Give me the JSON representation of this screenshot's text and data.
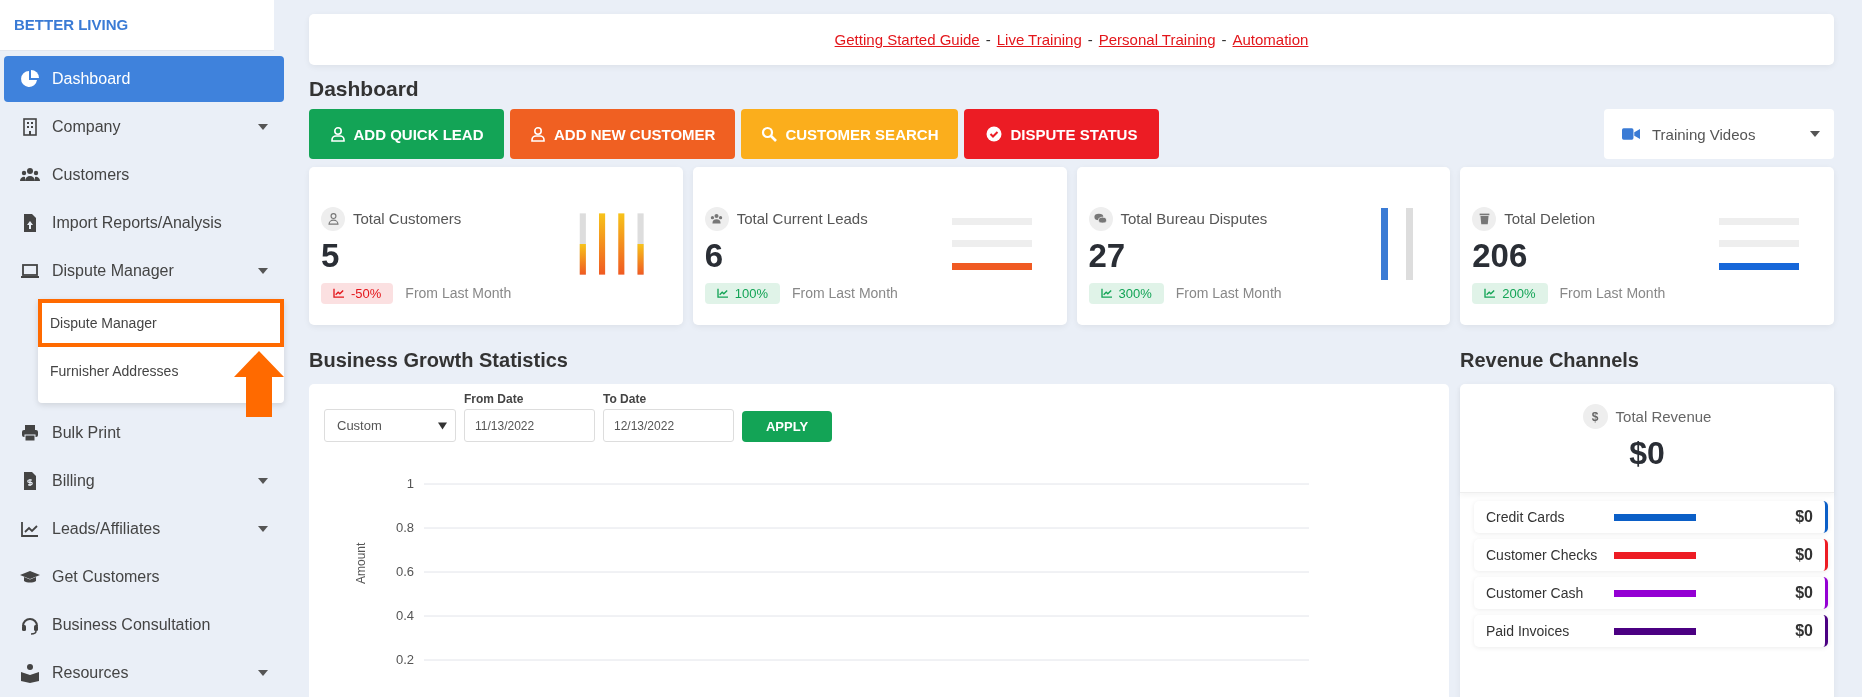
{
  "sidebar": {
    "brand": "BETTER LIVING",
    "items": [
      {
        "label": "Dashboard",
        "selected": true,
        "has_caret": false
      },
      {
        "label": "Company",
        "selected": false,
        "has_caret": true
      },
      {
        "label": "Customers",
        "selected": false,
        "has_caret": false
      },
      {
        "label": "Import Reports/Analysis",
        "selected": false,
        "has_caret": false
      },
      {
        "label": "Dispute Manager",
        "selected": false,
        "has_caret": true,
        "expanded": true,
        "children": [
          {
            "label": "Dispute Manager",
            "highlighted": true
          },
          {
            "label": "Furnisher Addresses",
            "highlighted": false
          }
        ]
      },
      {
        "label": "Bulk Print",
        "selected": false,
        "has_caret": false
      },
      {
        "label": "Billing",
        "selected": false,
        "has_caret": true
      },
      {
        "label": "Leads/Affiliates",
        "selected": false,
        "has_caret": true
      },
      {
        "label": "Get Customers",
        "selected": false,
        "has_caret": false
      },
      {
        "label": "Business Consultation",
        "selected": false,
        "has_caret": false
      },
      {
        "label": "Resources",
        "selected": false,
        "has_caret": true
      }
    ]
  },
  "banner": {
    "links": [
      "Getting Started Guide",
      "Live Training",
      "Personal Training",
      "Automation"
    ],
    "separator": "-"
  },
  "page_title": "Dashboard",
  "actions": [
    {
      "label": "ADD QUICK LEAD",
      "color": "#13a456"
    },
    {
      "label": "ADD NEW CUSTOMER",
      "color": "#f06022"
    },
    {
      "label": "CUSTOMER SEARCH",
      "color": "#fbae1c"
    },
    {
      "label": "DISPUTE STATUS",
      "color": "#ec1c24"
    }
  ],
  "training_dropdown": {
    "label": "Training Videos"
  },
  "stats": [
    {
      "title": "Total Customers",
      "value": "5",
      "change": "-50%",
      "color": "#e3161b",
      "note": "From Last Month",
      "kind": "gradient-bars"
    },
    {
      "title": "Total Current Leads",
      "value": "6",
      "change": "100%",
      "color": "#13a456",
      "note": "From Last Month",
      "kind": "orange-lines"
    },
    {
      "title": "Total Bureau Disputes",
      "value": "27",
      "change": "300%",
      "color": "#13a456",
      "note": "From Last Month",
      "kind": "blue-bars"
    },
    {
      "title": "Total Deletion",
      "value": "206",
      "change": "200%",
      "color": "#13a456",
      "note": "From Last Month",
      "kind": "blue-lines"
    }
  ],
  "growth": {
    "title": "Business Growth Statistics",
    "range": "Custom",
    "from_label": "From Date",
    "from": "11/13/2022",
    "to_label": "To Date",
    "to": "12/13/2022",
    "apply": "APPLY",
    "chart_data": {
      "type": "line",
      "categories": [
        null
      ],
      "ylabel": "Amount",
      "grid": true,
      "ylim": [
        0.2,
        1
      ],
      "yticks": [
        0.2,
        0.4,
        0.6,
        0.8,
        1
      ]
    }
  },
  "revenue": {
    "title": "Revenue Channels",
    "total_label": "Total Revenue",
    "total_icon": "$",
    "total": "$0",
    "channels": [
      {
        "name": "Credit Cards",
        "amount": "$0",
        "color": "#0b5fc7"
      },
      {
        "name": "Customer Checks",
        "amount": "$0",
        "color": "#ed1c24"
      },
      {
        "name": "Customer Cash",
        "amount": "$0",
        "color": "#9400d3"
      },
      {
        "name": "Paid Invoices",
        "amount": "$0",
        "color": "#4b0082"
      }
    ]
  }
}
